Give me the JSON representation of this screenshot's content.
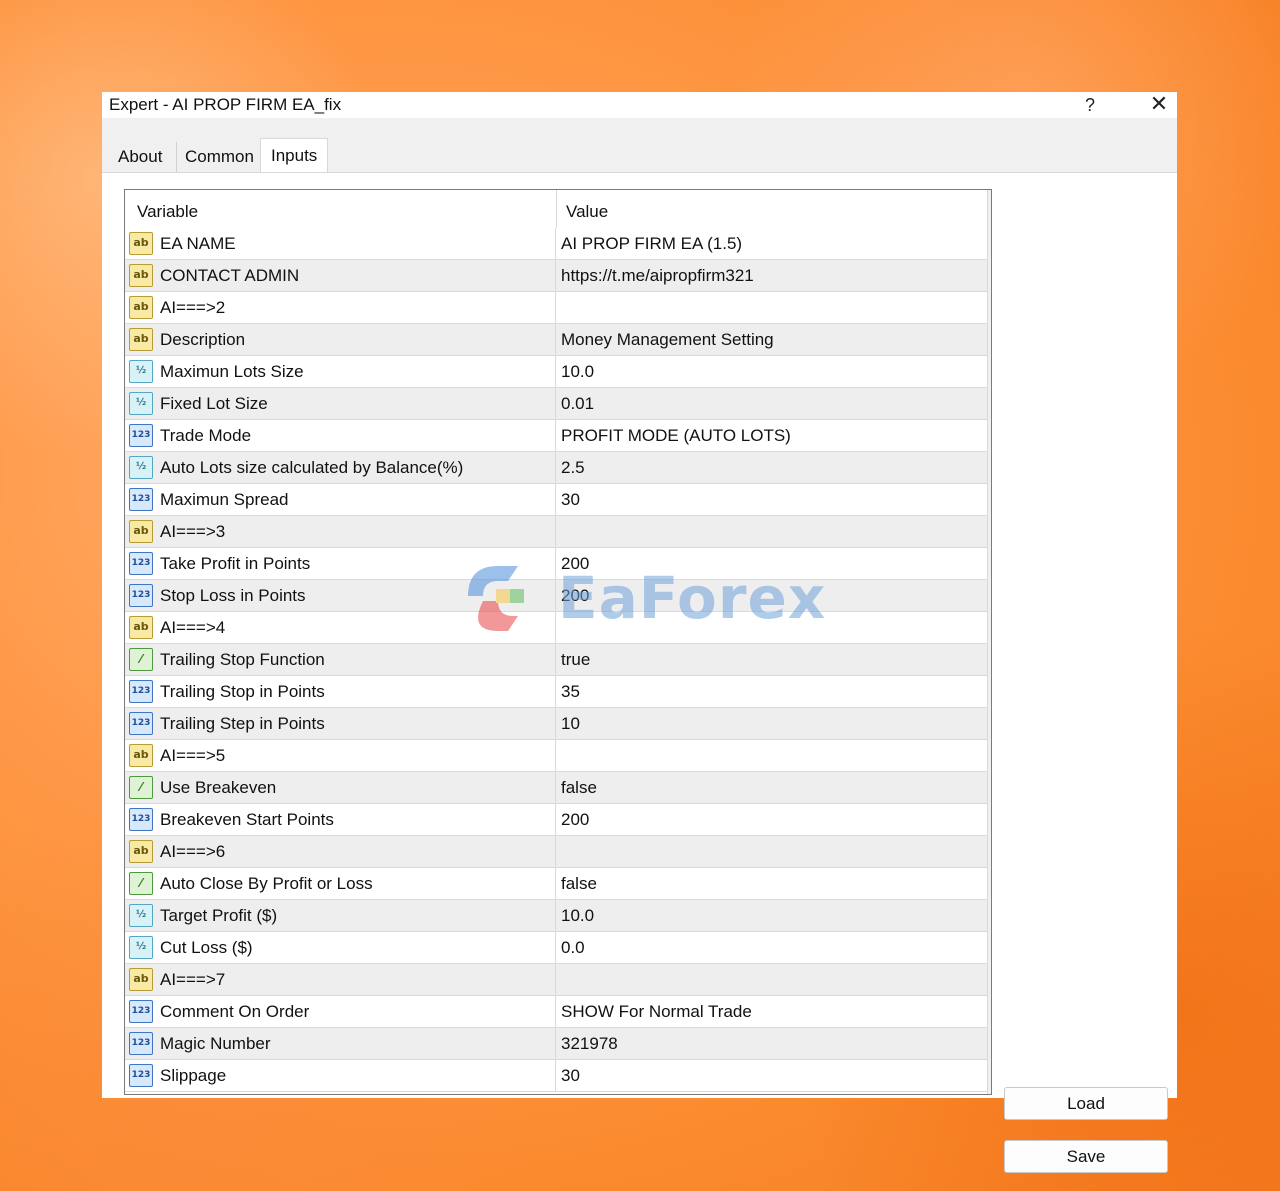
{
  "window": {
    "title": "Expert - AI PROP FIRM EA_fix",
    "help_label": "?",
    "close_label": "✕"
  },
  "tabs": [
    {
      "label": "About"
    },
    {
      "label": "Common"
    },
    {
      "label": "Inputs",
      "active": true
    }
  ],
  "grid": {
    "col_variable": "Variable",
    "col_value": "Value",
    "rows": [
      {
        "icon": "ab",
        "name": "EA NAME",
        "value": "AI PROP FIRM EA (1.5)"
      },
      {
        "icon": "ab",
        "name": "CONTACT ADMIN",
        "value": "https://t.me/aipropfirm321"
      },
      {
        "icon": "ab",
        "name": "AI===>2",
        "value": ""
      },
      {
        "icon": "ab",
        "name": "Description",
        "value": "Money Management Setting"
      },
      {
        "icon": "v2",
        "name": "Maximun Lots Size",
        "value": "10.0"
      },
      {
        "icon": "v2",
        "name": "Fixed Lot Size",
        "value": "0.01"
      },
      {
        "icon": "n123",
        "name": "Trade Mode",
        "value": "PROFIT MODE (AUTO LOTS)"
      },
      {
        "icon": "v2",
        "name": "Auto Lots size calculated by Balance(%)",
        "value": "2.5"
      },
      {
        "icon": "n123",
        "name": "Maximun Spread",
        "value": "30"
      },
      {
        "icon": "ab",
        "name": "AI===>3",
        "value": ""
      },
      {
        "icon": "n123",
        "name": "Take Profit in Points",
        "value": "200"
      },
      {
        "icon": "n123",
        "name": "Stop Loss in Points",
        "value": "200"
      },
      {
        "icon": "ab",
        "name": "AI===>4",
        "value": ""
      },
      {
        "icon": "bool",
        "name": "Trailing Stop Function",
        "value": "true"
      },
      {
        "icon": "n123",
        "name": "Trailing Stop in Points",
        "value": "35"
      },
      {
        "icon": "n123",
        "name": "Trailing Step in Points",
        "value": "10"
      },
      {
        "icon": "ab",
        "name": "AI===>5",
        "value": ""
      },
      {
        "icon": "bool",
        "name": "Use Breakeven",
        "value": "false"
      },
      {
        "icon": "n123",
        "name": "Breakeven Start Points",
        "value": "200"
      },
      {
        "icon": "ab",
        "name": "AI===>6",
        "value": ""
      },
      {
        "icon": "bool",
        "name": "Auto Close By Profit or Loss",
        "value": "false"
      },
      {
        "icon": "v2",
        "name": "Target Profit ($)",
        "value": "10.0"
      },
      {
        "icon": "v2",
        "name": "Cut Loss ($)",
        "value": "0.0"
      },
      {
        "icon": "ab",
        "name": "AI===>7",
        "value": ""
      },
      {
        "icon": "n123",
        "name": "Comment On Order",
        "value": "SHOW For Normal Trade"
      },
      {
        "icon": "n123",
        "name": "Magic Number",
        "value": "321978"
      },
      {
        "icon": "n123",
        "name": "Slippage",
        "value": "30"
      }
    ]
  },
  "icon_glyphs": {
    "ab": "ab",
    "v2": "½",
    "n123": "123",
    "bool": "⁄"
  },
  "buttons": {
    "load": "Load",
    "save": "Save"
  },
  "watermark": {
    "text": "EaForex"
  }
}
